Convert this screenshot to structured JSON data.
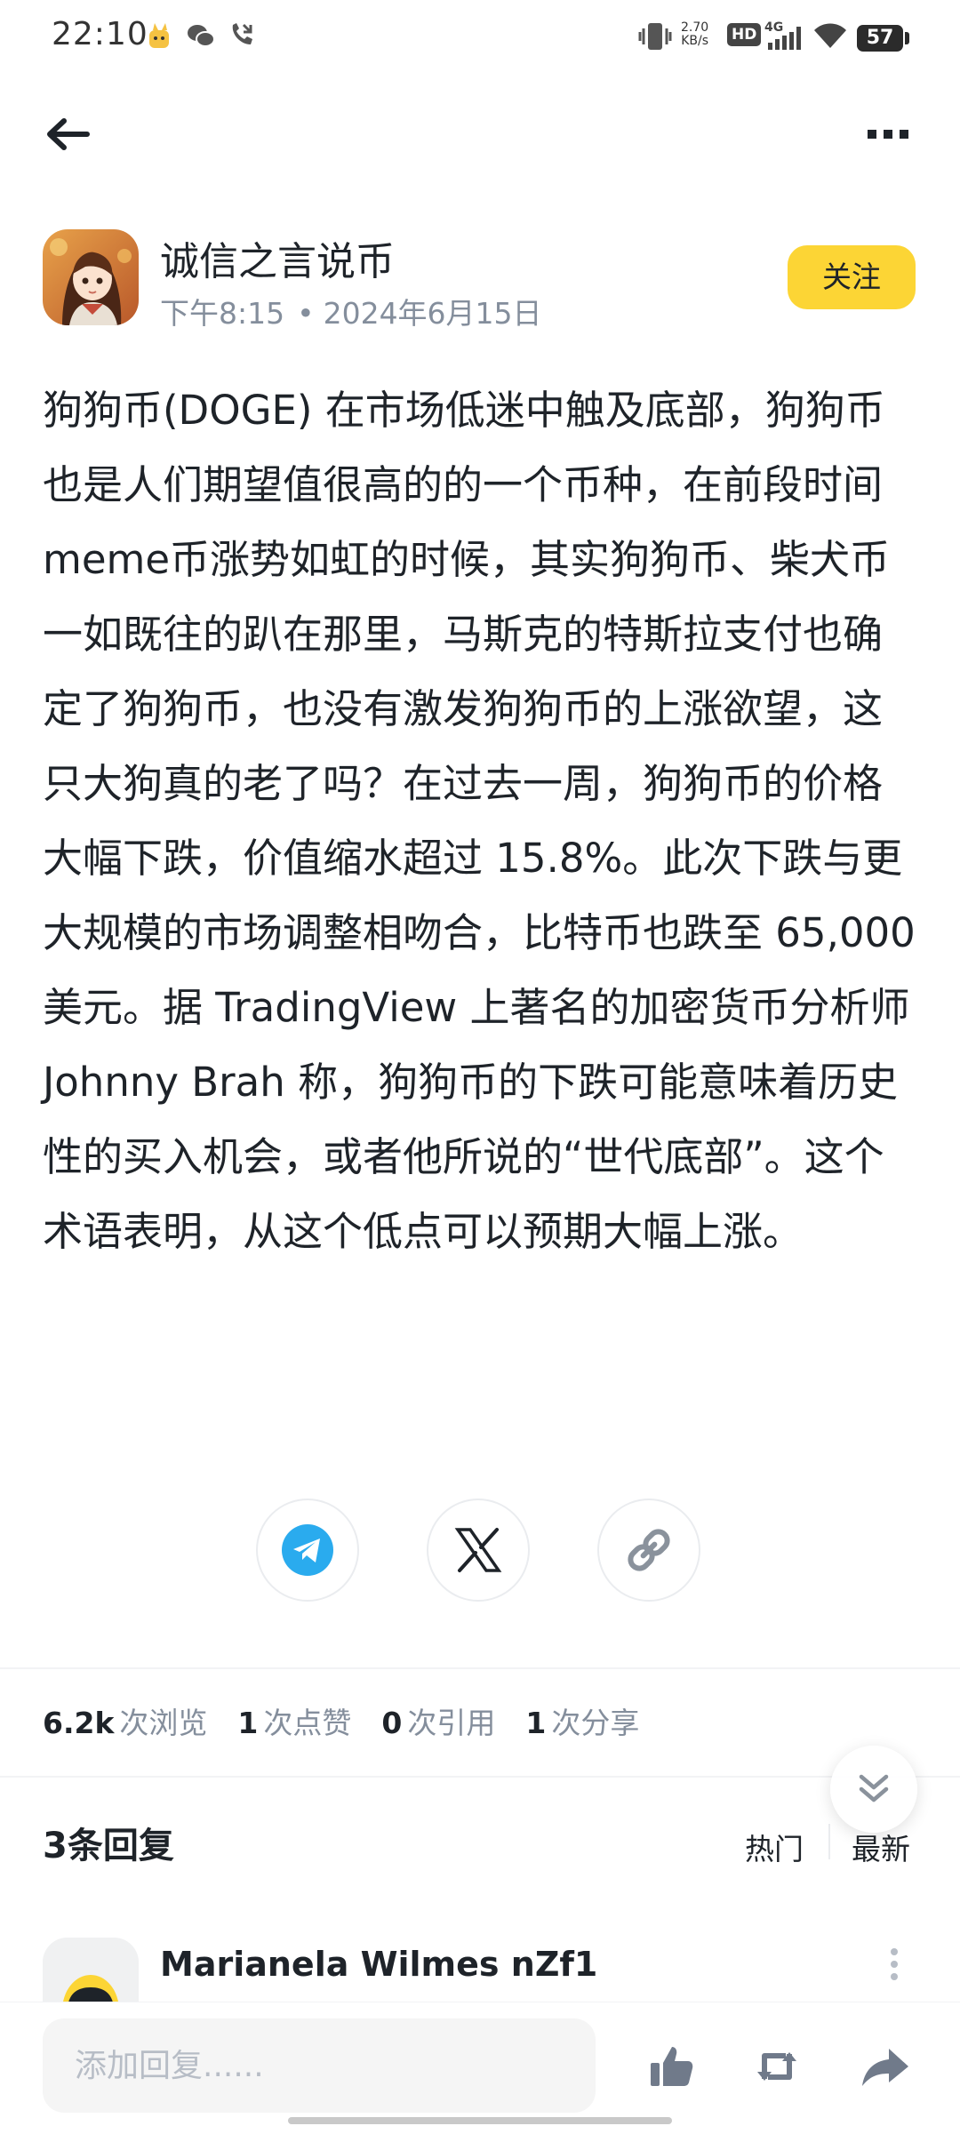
{
  "status_bar": {
    "time": "22:10",
    "net_speed_value": "2.70",
    "net_speed_unit": "KB/s",
    "hd_label": "HD",
    "network_type": "4G",
    "battery": "57"
  },
  "author": {
    "name": "诚信之言说币",
    "time": "下午8:15",
    "separator": "•",
    "date": "2024年6月15日",
    "follow_label": "关注"
  },
  "article": {
    "text": "狗狗币(DOGE) 在市场低迷中触及底部，狗狗币也是人们期望值很高的的一个币种，在前段时间meme币涨势如虹的时候，其实狗狗币、柴犬币一如既往的趴在那里，马斯克的特斯拉支付也确定了狗狗币，也没有激发狗狗币的上涨欲望，这只大狗真的老了吗？在过去一周，狗狗币的价格大幅下跌，价值缩水超过 15.8%。此次下跌与更大规模的市场调整相吻合，比特币也跌至 65,000 美元。据 TradingView 上著名的加密货币分析师 Johnny Brah 称，狗狗币的下跌可能意味着历史性的买入机会，或者他所说的“世代底部”。这个术语表明，从这个低点可以预期大幅上涨。"
  },
  "share": {
    "icons": [
      "telegram-icon",
      "x-icon",
      "link-icon"
    ]
  },
  "stats": {
    "views_count": "6.2k",
    "views_label": "次浏览",
    "likes_count": "1",
    "likes_label": "次点赞",
    "quotes_count": "0",
    "quotes_label": "次引用",
    "shares_count": "1",
    "shares_label": "次分享"
  },
  "replies": {
    "title": "3条回复",
    "sort_hot": "热门",
    "sort_new": "最新",
    "items": [
      {
        "name": "Marianela Wilmes nZf1"
      }
    ]
  },
  "bottom_bar": {
    "reply_placeholder": "添加回复......"
  },
  "colors": {
    "accent_yellow": "#fcd535",
    "text_primary": "#1e2329",
    "text_secondary": "#848e9c",
    "telegram_blue": "#2aabee"
  }
}
